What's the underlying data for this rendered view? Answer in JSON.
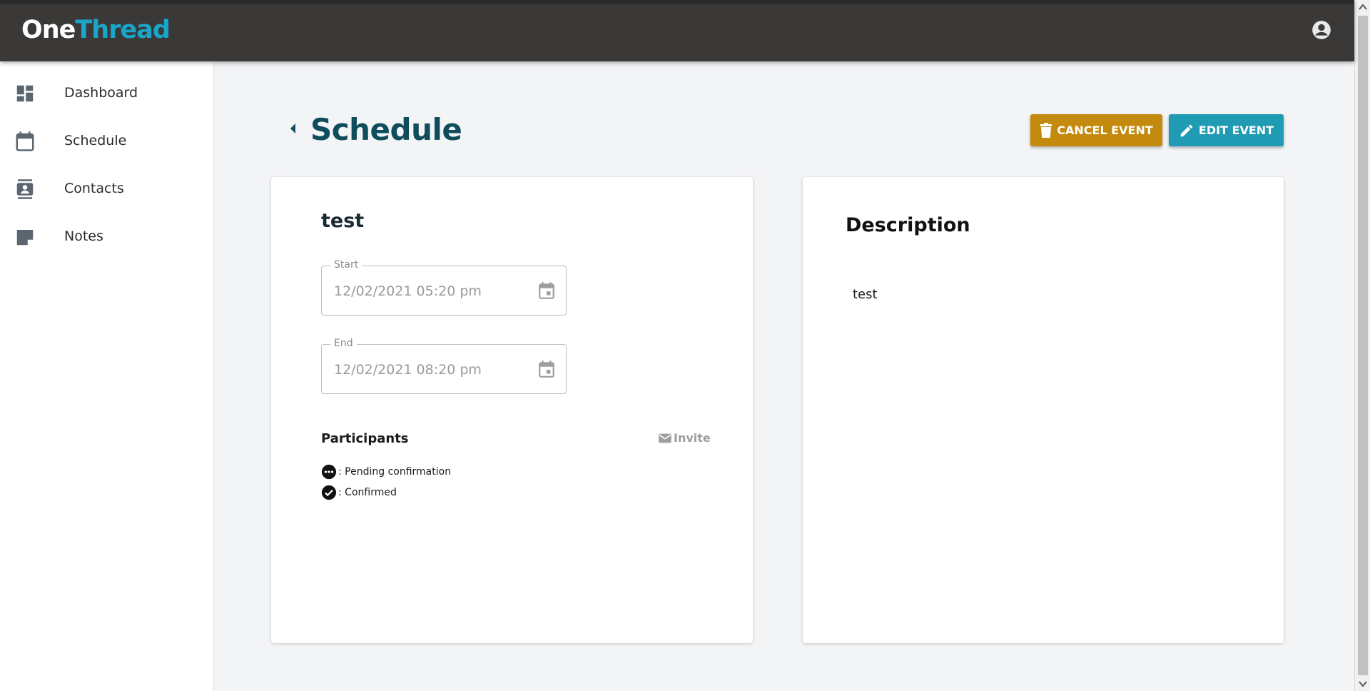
{
  "header": {
    "logo_part1": "One",
    "logo_part2": "Thread",
    "account_icon": "account-circle-icon"
  },
  "sidebar": {
    "items": [
      {
        "label": "Dashboard",
        "icon": "dashboard-icon"
      },
      {
        "label": "Schedule",
        "icon": "calendar-icon"
      },
      {
        "label": "Contacts",
        "icon": "contacts-icon"
      },
      {
        "label": "Notes",
        "icon": "note-icon"
      }
    ]
  },
  "page": {
    "title": "Schedule",
    "cancel_label": "CANCEL EVENT",
    "edit_label": "EDIT EVENT"
  },
  "event": {
    "title": "test",
    "start_label": "Start",
    "start_value": "12/02/2021 05:20 pm",
    "end_label": "End",
    "end_value": "12/02/2021 08:20 pm",
    "participants_label": "Participants",
    "invite_label": "Invite",
    "legend_pending": ": Pending confirmation",
    "legend_confirmed": ": Confirmed"
  },
  "description": {
    "title": "Description",
    "text": "test"
  },
  "colors": {
    "topbar": "#3a3938",
    "logo_accent": "#1aa6c9",
    "title": "#0f4c5c",
    "cancel_button": "#c48a0d",
    "edit_button": "#1f9bb3"
  }
}
